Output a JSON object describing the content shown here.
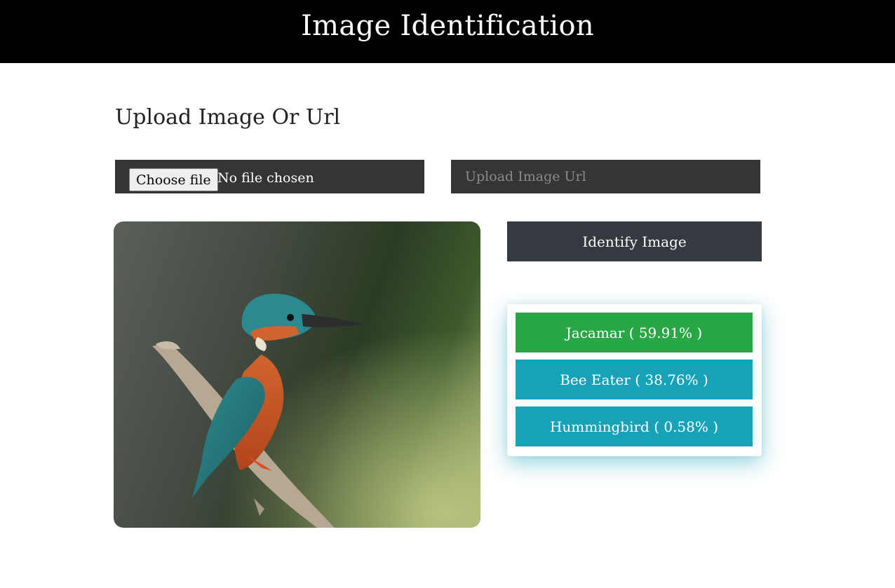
{
  "header": {
    "title": "Image Identification"
  },
  "upload": {
    "section_title": "Upload Image Or Url",
    "file_button_label": "Choose file",
    "file_status": "No file chosen",
    "url_placeholder": "Upload Image Url",
    "url_value": ""
  },
  "preview": {
    "alt": "kingfisher perched on branch"
  },
  "actions": {
    "identify_label": "Identify Image"
  },
  "results": [
    {
      "label": "Jacamar ( 59.91% )",
      "color": "#28a745"
    },
    {
      "label": "Bee Eater ( 38.76% )",
      "color": "#17a2b8"
    },
    {
      "label": "Hummingbird ( 0.58% )",
      "color": "#17a2b8"
    }
  ],
  "colors": {
    "header_bg": "#000000",
    "input_bg": "#353535",
    "button_bg": "#343a40",
    "top_result": "#28a745",
    "other_result": "#17a2b8"
  }
}
